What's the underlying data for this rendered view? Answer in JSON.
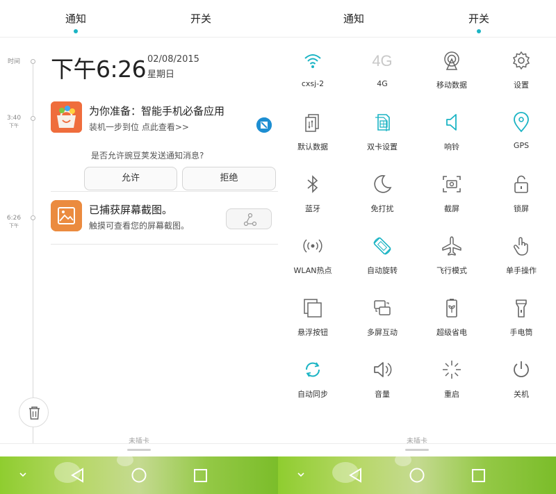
{
  "left_panel": {
    "tabs": [
      {
        "label": "通知",
        "active": true
      },
      {
        "label": "开关",
        "active": false
      }
    ],
    "timeline": {
      "time_marker": "时间",
      "markers": [
        {
          "time": "3:40",
          "period": "下午"
        },
        {
          "time": "6:26",
          "period": "下午"
        }
      ]
    },
    "clock": {
      "time": "下午6:26",
      "date": "02/08/2015",
      "weekday": "星期日"
    },
    "notifications": [
      {
        "title": "为你准备：智能手机必备应用",
        "text": "装机一步到位 点此查看>>",
        "question": "是否允许豌豆荚发送通知消息?",
        "allow_label": "允许",
        "deny_label": "拒绝"
      },
      {
        "title": "已捕获屏幕截图。",
        "text": "触摸可查看您的屏幕截图。"
      }
    ],
    "sim_status": "未插卡"
  },
  "right_panel": {
    "tabs": [
      {
        "label": "通知",
        "active": false
      },
      {
        "label": "开关",
        "active": true
      }
    ],
    "toggles": [
      {
        "label": "cxsj-2",
        "icon": "wifi-icon",
        "active": true
      },
      {
        "label": "4G",
        "icon": "4g-icon",
        "icon_text": "4G",
        "active": false
      },
      {
        "label": "移动数据",
        "icon": "mobile-data-icon",
        "active": false
      },
      {
        "label": "设置",
        "icon": "gear-icon",
        "active": false
      },
      {
        "label": "默认数据",
        "icon": "default-data-icon",
        "active": false
      },
      {
        "label": "双卡设置",
        "icon": "dual-sim-icon",
        "active": true
      },
      {
        "label": "响铃",
        "icon": "speaker-icon",
        "active": true
      },
      {
        "label": "GPS",
        "icon": "location-pin-icon",
        "active": true
      },
      {
        "label": "蓝牙",
        "icon": "bluetooth-icon",
        "active": false
      },
      {
        "label": "免打扰",
        "icon": "moon-icon",
        "active": false
      },
      {
        "label": "截屏",
        "icon": "screenshot-icon",
        "active": false
      },
      {
        "label": "锁屏",
        "icon": "lock-icon",
        "active": false
      },
      {
        "label": "WLAN热点",
        "icon": "hotspot-icon",
        "active": false
      },
      {
        "label": "自动旋转",
        "icon": "auto-rotate-icon",
        "active": true
      },
      {
        "label": "飞行模式",
        "icon": "airplane-icon",
        "active": false
      },
      {
        "label": "单手操作",
        "icon": "hand-icon",
        "active": false
      },
      {
        "label": "悬浮按钮",
        "icon": "floating-button-icon",
        "active": false
      },
      {
        "label": "多屏互动",
        "icon": "multiscreen-icon",
        "active": false
      },
      {
        "label": "超级省电",
        "icon": "battery-saver-icon",
        "active": false
      },
      {
        "label": "手电筒",
        "icon": "flashlight-icon",
        "active": false
      },
      {
        "label": "自动同步",
        "icon": "sync-icon",
        "active": true
      },
      {
        "label": "音量",
        "icon": "volume-icon",
        "active": false
      },
      {
        "label": "重启",
        "icon": "restart-icon",
        "active": false
      },
      {
        "label": "关机",
        "icon": "power-icon",
        "active": false
      }
    ],
    "sim_status": "未插卡"
  },
  "colors": {
    "accent": "#1bb4c4",
    "icon_inactive": "#666666",
    "icon_disabled": "#c8c8c8"
  },
  "navigation": [
    "chevron-down-icon",
    "back-icon",
    "home-icon",
    "recents-icon"
  ]
}
